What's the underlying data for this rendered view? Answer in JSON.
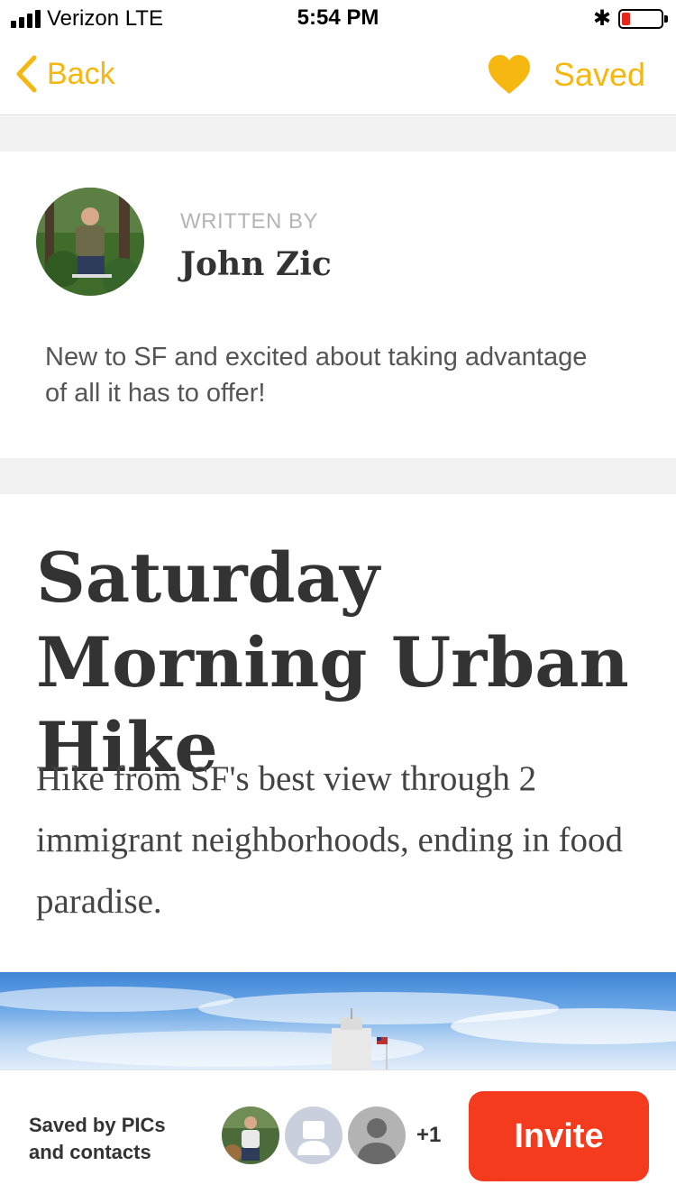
{
  "status_bar": {
    "carrier": "Verizon  LTE",
    "time": "5:54 PM",
    "battery_level": 0.1
  },
  "nav": {
    "back_label": "Back",
    "saved_label": "Saved",
    "accent_color": "#f6b711"
  },
  "author": {
    "written_by_label": "WRITTEN BY",
    "name": "John Zic",
    "bio": "New to SF and excited about taking advantage of all it has to offer!"
  },
  "article": {
    "title": "Saturday Morning Urban Hike",
    "summary": "Hike from SF's best view through 2 immigrant neighborhoods, ending in food paradise."
  },
  "bottom_bar": {
    "saved_by_line1": "Saved by PICs",
    "saved_by_line2": "and contacts",
    "extra_count": "+1",
    "invite_label": "Invite",
    "invite_color": "#f53b1e"
  },
  "icons": {
    "back": "chevron-left-icon",
    "saved": "heart-icon",
    "bluetooth": "bluetooth-icon",
    "battery": "battery-icon"
  }
}
